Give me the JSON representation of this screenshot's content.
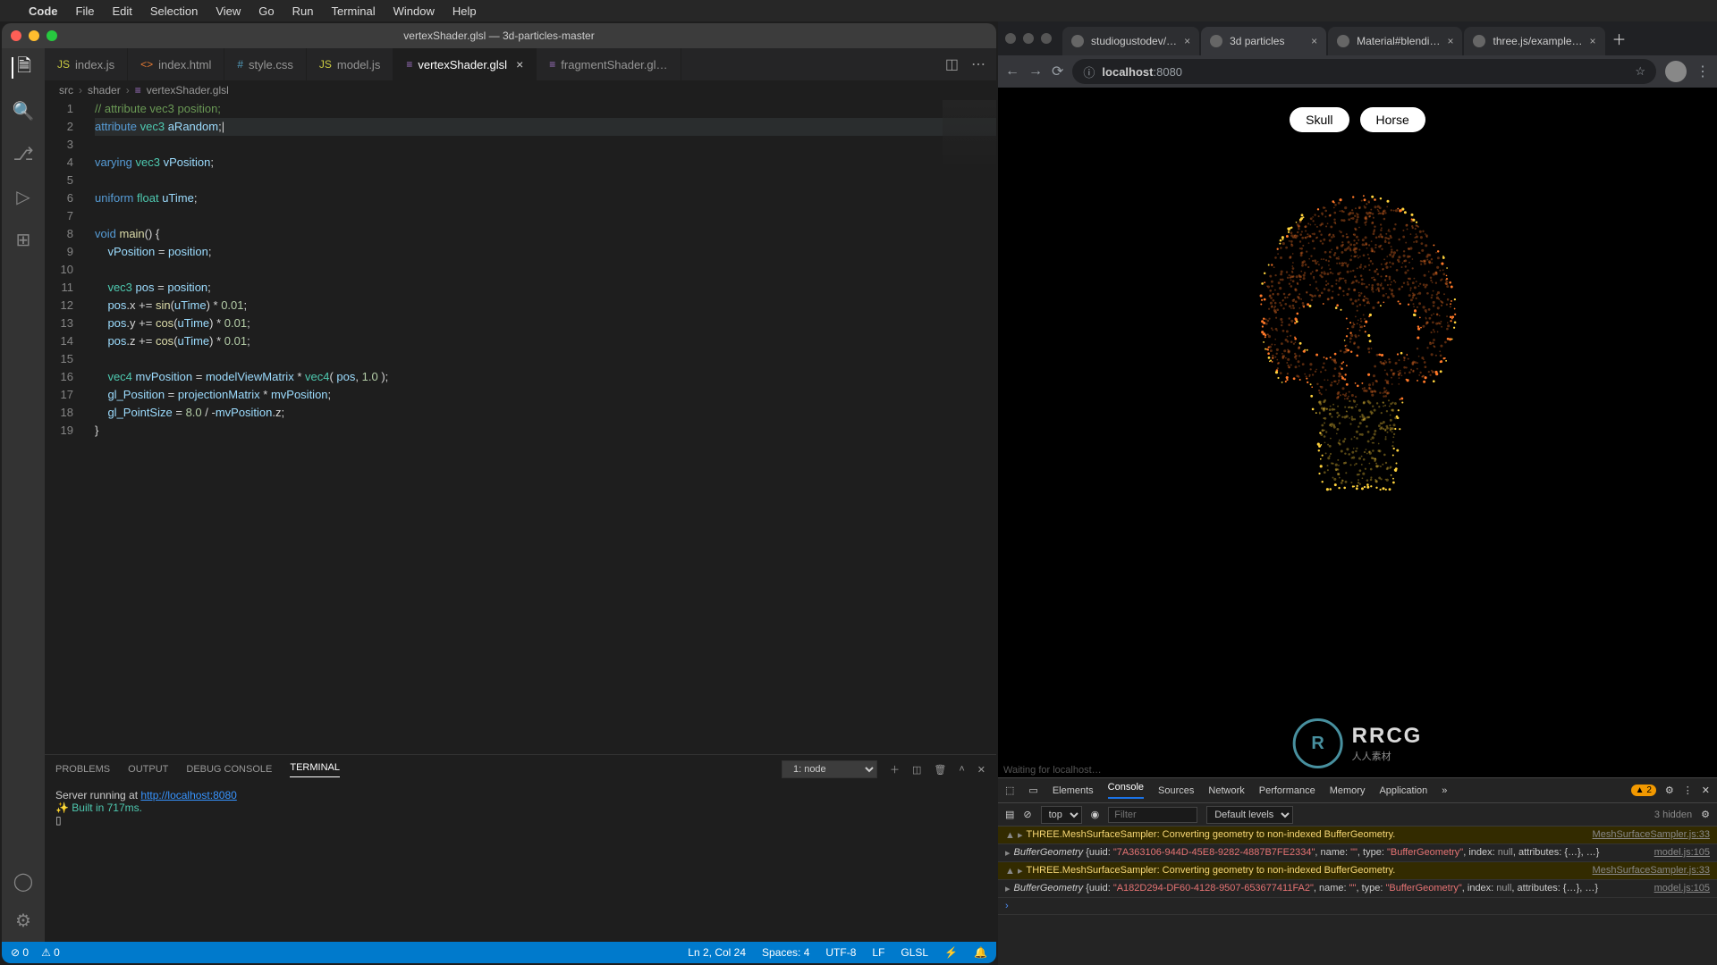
{
  "menubar": {
    "app": "Code",
    "items": [
      "File",
      "Edit",
      "Selection",
      "View",
      "Go",
      "Run",
      "Terminal",
      "Window",
      "Help"
    ]
  },
  "titlebar": "vertexShader.glsl — 3d-particles-master",
  "tabs": [
    {
      "icon": "JS",
      "label": "index.js",
      "color": "#cbcb41"
    },
    {
      "icon": "<>",
      "label": "index.html",
      "color": "#e37933"
    },
    {
      "icon": "#",
      "label": "style.css",
      "color": "#519aba"
    },
    {
      "icon": "JS",
      "label": "model.js",
      "color": "#cbcb41"
    },
    {
      "icon": "≡",
      "label": "vertexShader.glsl",
      "color": "#a074c4",
      "active": true,
      "dirty": true
    },
    {
      "icon": "≡",
      "label": "fragmentShader.gl…",
      "color": "#a074c4"
    }
  ],
  "breadcrumb": [
    "src",
    "shader",
    "vertexShader.glsl"
  ],
  "code_lines": 19,
  "panel": {
    "tabs": [
      "PROBLEMS",
      "OUTPUT",
      "DEBUG CONSOLE",
      "TERMINAL"
    ],
    "active": 3,
    "dropdown": "1: node",
    "term_line1_pre": "Server running at ",
    "term_line1_link": "http://localhost:8080",
    "term_line2": "Built in 717ms.",
    "prompt": "▯"
  },
  "statusbar": {
    "left": [
      "⊘ 0",
      "⚠ 0"
    ],
    "right": [
      "Ln 2, Col 24",
      "Spaces: 4",
      "UTF-8",
      "LF",
      "GLSL",
      "⚡",
      "🔔"
    ]
  },
  "chrome_tabs": [
    {
      "label": "studiogustodev/…",
      "icon": "gh"
    },
    {
      "label": "3d particles",
      "active": true
    },
    {
      "label": "Material#blendi…",
      "icon": "gh"
    },
    {
      "label": "three.js/example…",
      "icon": "gh"
    }
  ],
  "omnibox": {
    "host": "localhost",
    "port": ":8080"
  },
  "page_buttons": [
    "Skull",
    "Horse"
  ],
  "page_status": "Waiting for localhost…",
  "devtools": {
    "tabs": [
      "Elements",
      "Console",
      "Sources",
      "Network",
      "Performance",
      "Memory",
      "Application"
    ],
    "active": 1,
    "warn_count": "▲ 2",
    "filter_placeholder": "Filter",
    "levels": "Default levels",
    "hidden": "3 hidden",
    "scope": "top",
    "rows": [
      {
        "type": "warn",
        "msg": "THREE.MeshSurfaceSampler: Converting geometry to non-indexed BufferGeometry.",
        "src": "MeshSurfaceSampler.js:33"
      },
      {
        "type": "log",
        "msg_obj": "BufferGeometry",
        "uuid": "7A363106-944D-45E8-9282-4887B7FE2334",
        "type_name": "BufferGeometry",
        "src": "model.js:105"
      },
      {
        "type": "warn",
        "msg": "THREE.MeshSurfaceSampler: Converting geometry to non-indexed BufferGeometry.",
        "src": "MeshSurfaceSampler.js:33"
      },
      {
        "type": "log",
        "msg_obj": "BufferGeometry",
        "uuid": "A182D294-DF60-4128-9507-653677411FA2",
        "type_name": "BufferGeometry",
        "src": "model.js:105"
      }
    ]
  },
  "watermark": {
    "logo": "R",
    "text": "RRCG",
    "sub": "人人素材"
  }
}
